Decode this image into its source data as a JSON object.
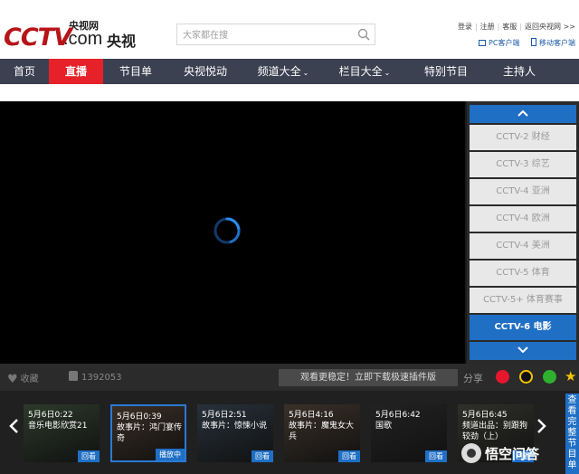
{
  "header": {
    "logo_text": "CCTV",
    "logo_com": ".com",
    "logo_top": "央视网",
    "logo_cn": "央视",
    "search_placeholder": "大家都在搜",
    "links": [
      "登录",
      "注册",
      "客服",
      "返回央视网 >>"
    ],
    "clients": [
      "PC客户端",
      "移动客户端"
    ]
  },
  "nav": {
    "items": [
      {
        "label": "首页",
        "width": 54
      },
      {
        "label": "直播",
        "width": 60,
        "active": true
      },
      {
        "label": "节目单",
        "width": 72
      },
      {
        "label": "央视悦动",
        "width": 82
      },
      {
        "label": "频道大全",
        "width": 90,
        "dropdown": true
      },
      {
        "label": "栏目大全",
        "width": 90,
        "dropdown": true
      },
      {
        "label": "特别节目",
        "width": 90
      },
      {
        "label": "主持人",
        "width": 72
      }
    ]
  },
  "channels": {
    "items": [
      {
        "label": "CCTV-2 财经"
      },
      {
        "label": "CCTV-3 综艺"
      },
      {
        "label": "CCTV-4 亚洲"
      },
      {
        "label": "CCTV-4 欧洲"
      },
      {
        "label": "CCTV-4 美洲"
      },
      {
        "label": "CCTV-5 体育"
      },
      {
        "label": "CCTV-5+ 体育赛事"
      },
      {
        "label": "CCTV-6 电影",
        "active": true
      }
    ]
  },
  "toolbar": {
    "fav_label": "收藏",
    "like_count": "1392053",
    "plugin_label": "观看更稳定！立即下载极速插件版",
    "share_label": "分享"
  },
  "schedule": {
    "items": [
      {
        "time": "5月6日0:22",
        "title": "音乐电影欣赏21",
        "button": "回看"
      },
      {
        "time": "5月6日0:39",
        "title": "故事片：鸿门宴传奇",
        "button": "播放中",
        "active": true
      },
      {
        "time": "5月6日2:51",
        "title": "故事片：惊悚小说",
        "button": "回看"
      },
      {
        "time": "5月6日4:16",
        "title": "故事片：魔鬼女大兵",
        "button": "回看"
      },
      {
        "time": "5月6日6:42",
        "title": "国歌",
        "button": "回看"
      },
      {
        "time": "5月6日6:45",
        "title": "频道出品：别跟狗较劲（上）",
        "button": "回看"
      }
    ],
    "view_all": "查看完整节目单"
  },
  "watermark": "悟空问答",
  "colors": {
    "brand_red": "#e62129",
    "accent_blue": "#1f6fc5",
    "nav_bg": "#3b4150"
  }
}
